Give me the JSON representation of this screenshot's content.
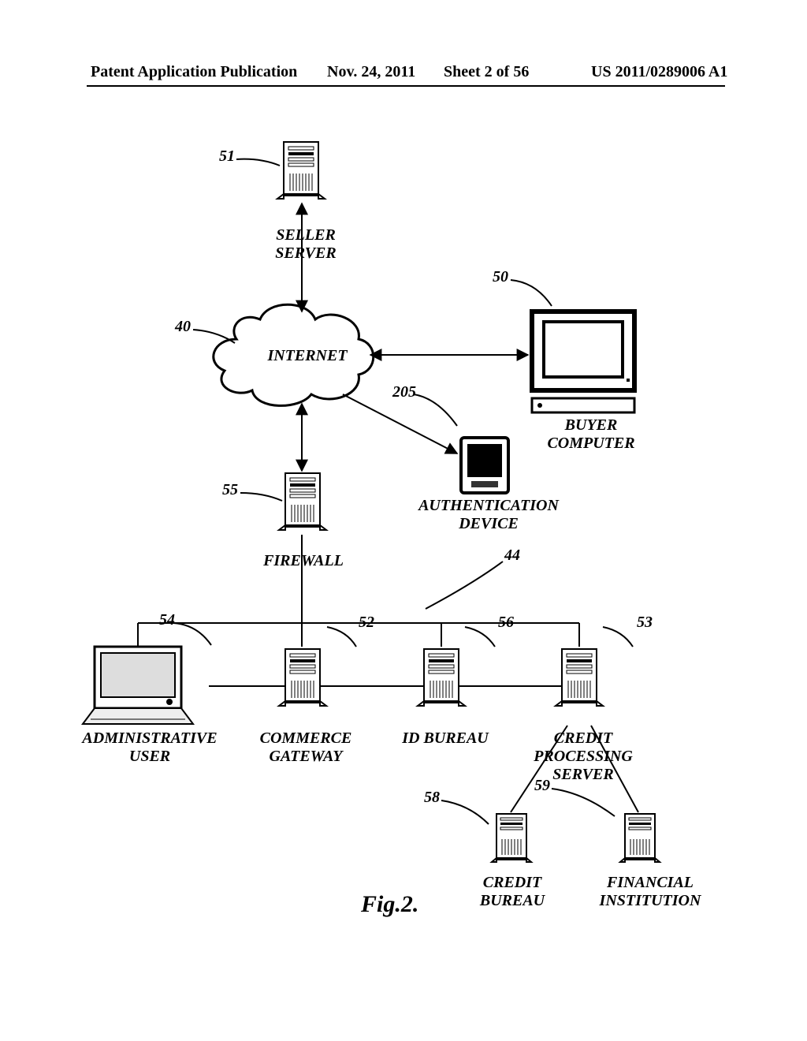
{
  "header": {
    "left": "Patent Application Publication",
    "date": "Nov. 24, 2011",
    "sheet": "Sheet 2 of 56",
    "pub": "US 2011/0289006 A1"
  },
  "labels": {
    "seller_server": "SELLER\nSERVER",
    "internet": "INTERNET",
    "buyer_computer": "BUYER\nCOMPUTER",
    "auth_device": "AUTHENTICATION\nDEVICE",
    "firewall": "FIREWALL",
    "admin_user": "ADMINISTRATIVE\nUSER",
    "commerce_gateway": "COMMERCE\nGATEWAY",
    "id_bureau": "ID BUREAU",
    "credit_processing": "CREDIT\nPROCESSING\nSERVER",
    "credit_bureau": "CREDIT\nBUREAU",
    "financial_institution": "FINANCIAL\nINSTITUTION"
  },
  "refs": {
    "seller_server": "51",
    "internet": "40",
    "buyer_computer": "50",
    "auth_device": "205",
    "firewall": "55",
    "network": "44",
    "admin_user": "54",
    "commerce_gateway": "52",
    "id_bureau": "56",
    "credit_processing": "53",
    "credit_bureau": "58",
    "financial_institution": "59"
  },
  "figure": "Fig.2."
}
